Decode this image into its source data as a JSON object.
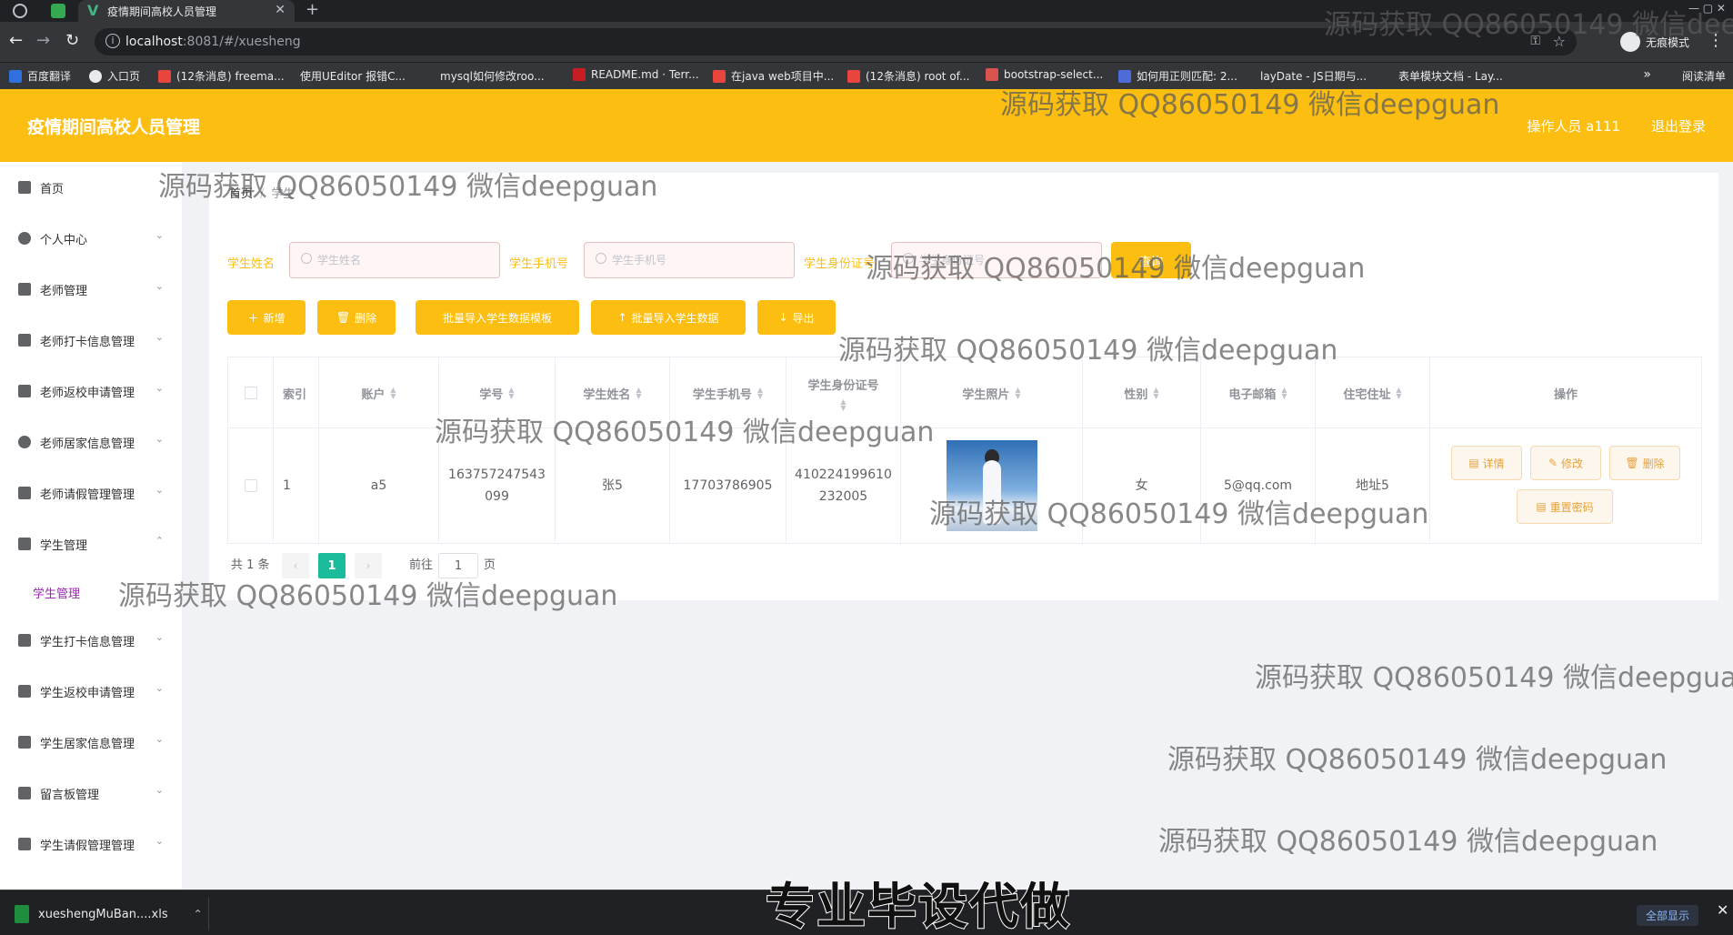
{
  "browser": {
    "tab_title": "疫情期间高校人员管理",
    "url_host": "localhost",
    "url_rest": ":8081/#/xuesheng",
    "incognito_label": "无痕模式",
    "reading_list": "阅读清单",
    "bookmarks": [
      {
        "label": "百度翻译",
        "color": "#2f6fde"
      },
      {
        "label": "入口页",
        "color": "#e8eaed"
      },
      {
        "label": "(12条消息) freema...",
        "color": "#e8453c"
      },
      {
        "label": "使用UEditor 报错C...",
        "color": "#35363a"
      },
      {
        "label": "mysql如何修改roo...",
        "color": "#35363a"
      },
      {
        "label": "README.md · Terr...",
        "color": "#c71d23"
      },
      {
        "label": "在java web项目中...",
        "color": "#e8453c"
      },
      {
        "label": "(12条消息) root of...",
        "color": "#e8453c"
      },
      {
        "label": "bootstrap-select...",
        "color": "#d9534f"
      },
      {
        "label": "如何用正则匹配: 2...",
        "color": "#4f6bd8"
      },
      {
        "label": "layDate - JS日期与...",
        "color": "#35363a"
      },
      {
        "label": "表单模块文档 - Lay...",
        "color": "#35363a"
      }
    ]
  },
  "header": {
    "title": "疫情期间高校人员管理",
    "operator": "操作人员 a111",
    "logout": "退出登录"
  },
  "sidebar": {
    "items": [
      {
        "label": "首页",
        "icon": "home-icon"
      },
      {
        "label": "个人中心",
        "icon": "user-icon"
      },
      {
        "label": "老师管理",
        "icon": "book-icon"
      },
      {
        "label": "老师打卡信息管理",
        "icon": "sliders-icon"
      },
      {
        "label": "老师返校申请管理",
        "icon": "send-icon"
      },
      {
        "label": "老师居家信息管理",
        "icon": "globe-icon"
      },
      {
        "label": "老师请假管理管理",
        "icon": "list-icon"
      },
      {
        "label": "学生管理",
        "icon": "mic-icon"
      },
      {
        "label": "学生打卡信息管理",
        "icon": "fullscreen-icon"
      },
      {
        "label": "学生返校申请管理",
        "icon": "person-icon"
      },
      {
        "label": "学生居家信息管理",
        "icon": "grid-icon"
      },
      {
        "label": "留言板管理",
        "icon": "message-icon"
      },
      {
        "label": "学生请假管理管理",
        "icon": "cart-icon"
      }
    ],
    "active_sub": "学生管理"
  },
  "breadcrumb": {
    "home": "首页",
    "current": "学生"
  },
  "filters": {
    "name_label": "学生姓名",
    "name_placeholder": "学生姓名",
    "phone_label": "学生手机号",
    "phone_placeholder": "学生手机号",
    "id_label": "学生身份证号",
    "id_placeholder": "学生身份证号",
    "search": "查询"
  },
  "actions": {
    "add": "新增",
    "delete": "删除",
    "import_template": "批量导入学生数据模板",
    "import": "批量导入学生数据",
    "export": "导出"
  },
  "table": {
    "headers": [
      "索引",
      "账户",
      "学号",
      "学生姓名",
      "学生手机号",
      "学生身份证号",
      "学生照片",
      "性别",
      "电子邮箱",
      "住宅住址",
      "操作"
    ],
    "rows": [
      {
        "index": "1",
        "account": "a5",
        "student_no_1": "163757247543",
        "student_no_2": "099",
        "name": "张5",
        "phone": "17703786905",
        "id_1": "410224199610",
        "id_2": "232005",
        "gender": "女",
        "email": "5@qq.com",
        "address": "地址5"
      }
    ],
    "ops": {
      "detail": "详情",
      "edit": "修改",
      "delete": "删除",
      "reset_pwd": "重置密码"
    }
  },
  "pagination": {
    "total": "共 1 条",
    "current": "1",
    "goto_prefix": "前往",
    "goto_value": "1",
    "goto_suffix": "页"
  },
  "downloads": {
    "file": "xueshengMuBan....xls",
    "show_all": "全部显示"
  },
  "watermark": "源码获取 QQ86050149 微信deepguan",
  "subtitle": "专业毕设代做",
  "colors": {
    "primary": "#fcbf11",
    "page_active": "#1abc9c",
    "submenu_active": "#9c27b0"
  }
}
